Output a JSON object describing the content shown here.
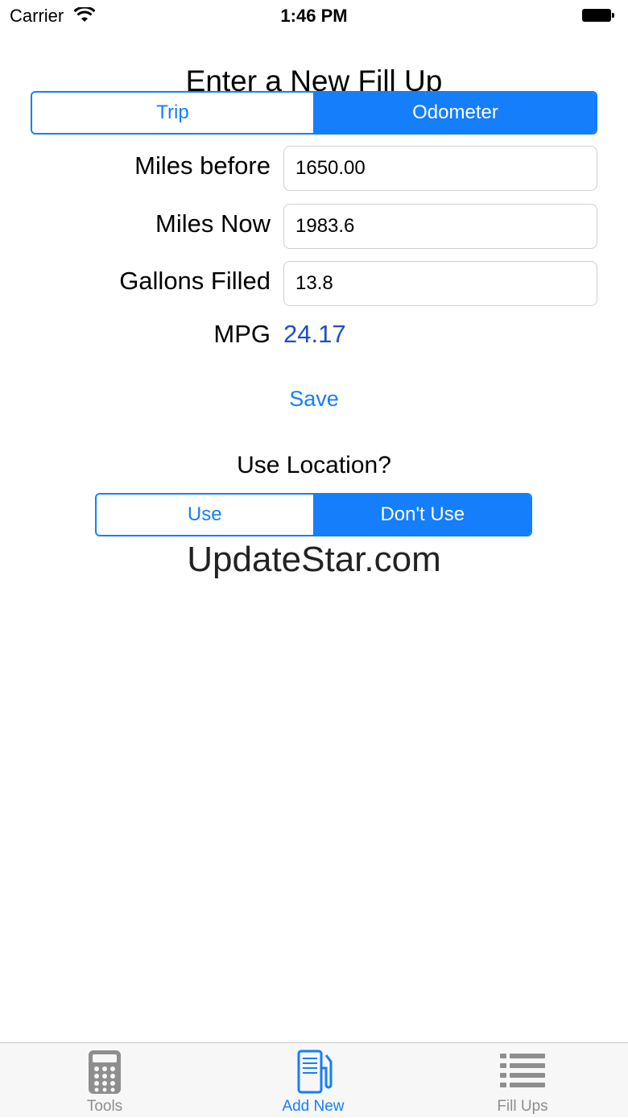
{
  "status_bar": {
    "carrier": "Carrier",
    "time": "1:46 PM",
    "wifi_icon": "wifi-icon",
    "battery_icon": "battery-icon"
  },
  "title": "Enter a New Fill Up",
  "mode_segment": {
    "options": [
      "Trip",
      "Odometer"
    ],
    "selected": "Odometer"
  },
  "fields": {
    "miles_before": {
      "label": "Miles before",
      "value": "1650.00"
    },
    "miles_now": {
      "label": "Miles Now",
      "value": "1983.6"
    },
    "gallons_filled": {
      "label": "Gallons Filled",
      "value": "13.8"
    }
  },
  "mpg": {
    "label": "MPG",
    "value": "24.17"
  },
  "save_label": "Save",
  "location": {
    "question": "Use Location?",
    "options": [
      "Use",
      "Don't Use"
    ],
    "selected": "Don't Use"
  },
  "watermark": "UpdateStar.com",
  "tab_bar": {
    "tabs": [
      {
        "label": "Tools",
        "icon": "calculator-icon",
        "active": false
      },
      {
        "label": "Add New",
        "icon": "gas-pump-icon",
        "active": true
      },
      {
        "label": "Fill Ups",
        "icon": "list-icon",
        "active": false
      }
    ]
  },
  "colors": {
    "accent": "#157efb",
    "mpg_value": "#1d4fc6",
    "tab_inactive": "#8e8e8e"
  }
}
